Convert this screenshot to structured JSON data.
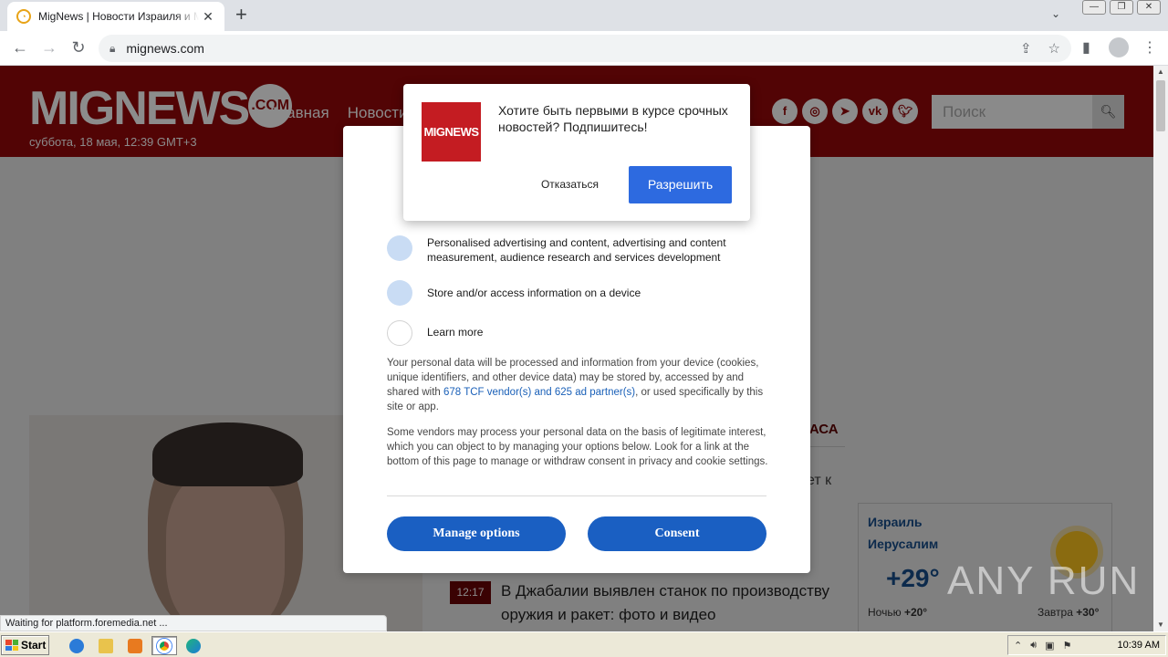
{
  "browser": {
    "tab_title": "MigNews | Новости Израиля и Мира",
    "url": "mignews.com",
    "status_text": "Waiting for platform.foremedia.net ..."
  },
  "site": {
    "logo_text": "MIGNEWS",
    "logo_suffix": ".COM",
    "date": "суббота, 18 мая, 12:39 GMT+3",
    "menu": [
      "Главная",
      "Новости"
    ],
    "social_icons": [
      "facebook-icon",
      "instagram-icon",
      "telegram-icon",
      "vk-icon",
      "twitter-icon"
    ],
    "search_placeholder": "Поиск"
  },
  "push_prompt": {
    "logo": "MIGNEWS",
    "message": "Хотите быть первыми в курсе срочных новостей? Подпишитесь!",
    "deny_label": "Отказаться",
    "allow_label": "Разрешить"
  },
  "consent": {
    "purposes": [
      {
        "text": "Personalised advertising and content, advertising and content measurement, audience research and services development"
      },
      {
        "text": "Store and/or access information on a device"
      },
      {
        "text": "Learn more"
      }
    ],
    "paragraph1_before": "Your personal data will be processed and information from your device (cookies, unique identifiers, and other device data) may be stored by, accessed by and shared with ",
    "paragraph1_link": "678 TCF vendor(s) and 625 ad partner(s)",
    "paragraph1_after": ", or used specifically by this site or app.",
    "paragraph2": "Some vendors may process your personal data on the basis of legitimate interest, which you can object to by managing your options below. Look for a link at the bottom of this page to manage or withdraw consent in privacy and cookie settings.",
    "manage_label": "Manage options",
    "consent_label": "Consent"
  },
  "news": {
    "tab_fragment": "НАСА",
    "title_fragment": "ет к",
    "item": {
      "time": "12:17",
      "title": "В Джабалии выявлен станок по производству оружия и ракет: фото и видео"
    }
  },
  "weather": {
    "country": "Израиль",
    "city": "Иерусалим",
    "temp": "+29°",
    "night_label": "Ночью",
    "night_temp": "+20°",
    "tomorrow_label": "Завтра",
    "tomorrow_temp": "+30°"
  },
  "watermark": "ANY RUN",
  "taskbar": {
    "start_label": "Start",
    "clock": "10:39 AM"
  }
}
